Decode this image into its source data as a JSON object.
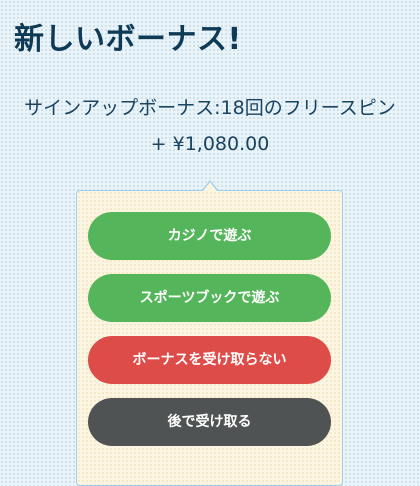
{
  "header": {
    "title": "新しいボーナス!"
  },
  "bonus": {
    "description": "サインアップボーナス:18回のフリースピン + ¥1,080.00"
  },
  "actions": {
    "play_casino": "カジノで遊ぶ",
    "play_sportsbook": "スポーツブックで遊ぶ",
    "decline_bonus": "ボーナスを受け取らない",
    "claim_later": "後で受け取る"
  },
  "colors": {
    "primary_green": "#55b55a",
    "danger_red": "#dd4c49",
    "dark_gray": "#505353",
    "title_navy": "#0e3a56"
  }
}
